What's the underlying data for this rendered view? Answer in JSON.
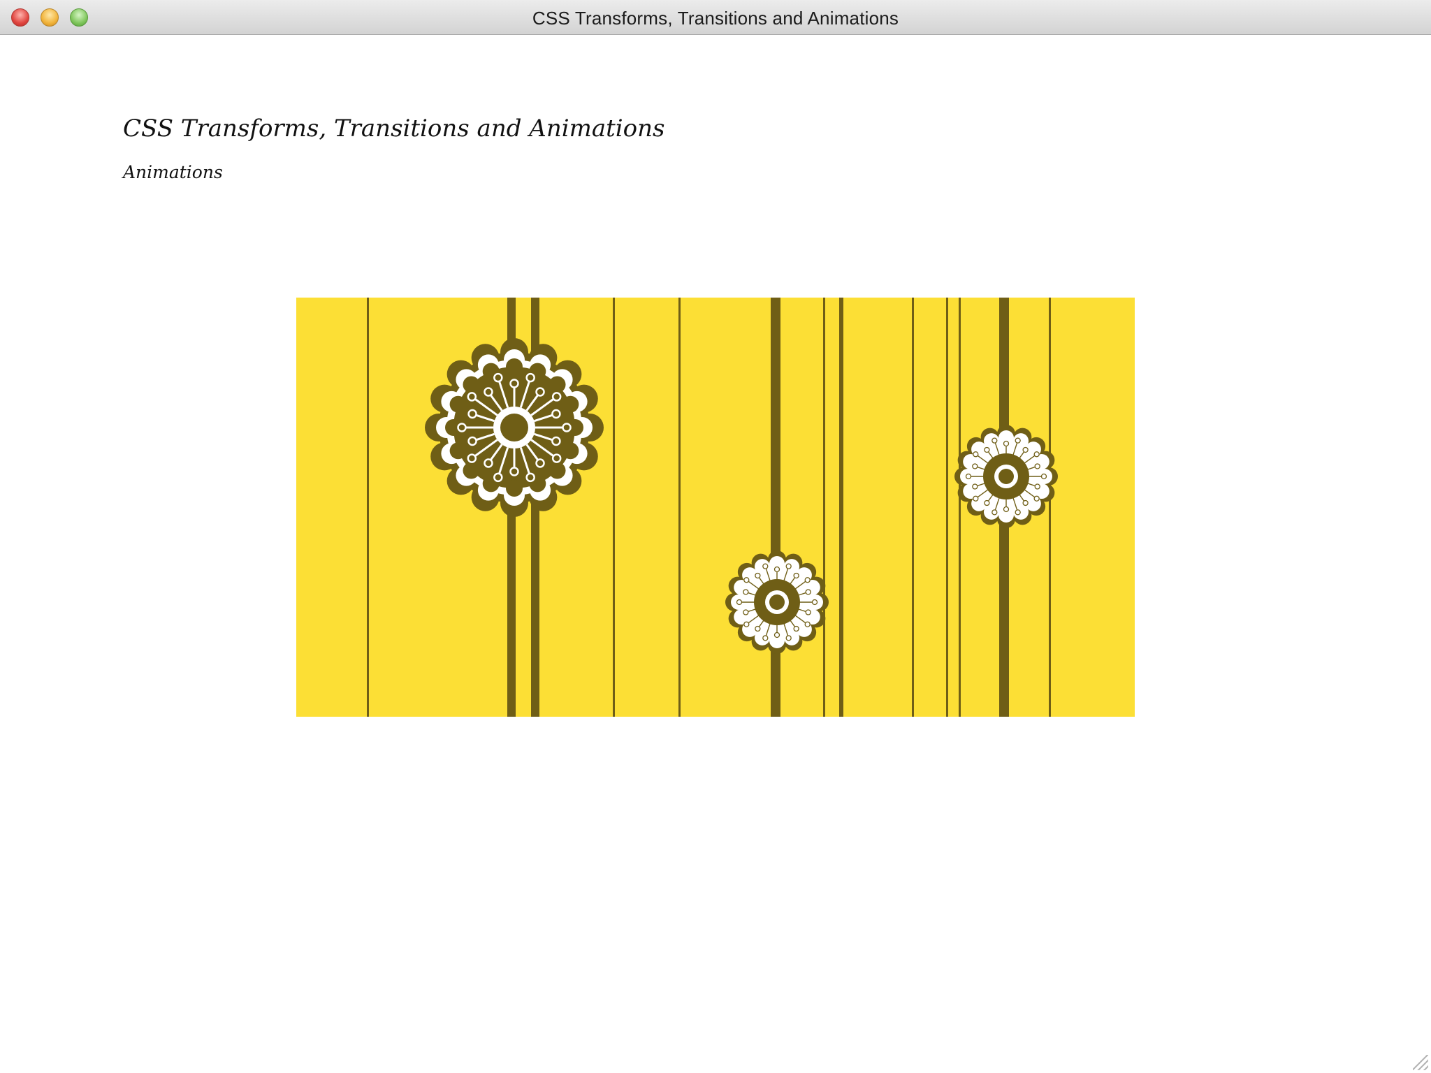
{
  "window": {
    "title": "CSS Transforms, Transitions and Animations"
  },
  "page": {
    "heading": "CSS Transforms, Transitions and Animations",
    "subheading": "Animations"
  },
  "stage": {
    "colors": {
      "background": "#fcdf35",
      "stripe": "#6f5e16",
      "flower_dark": "#6f5e16",
      "flower_light": "#ffffff"
    }
  }
}
